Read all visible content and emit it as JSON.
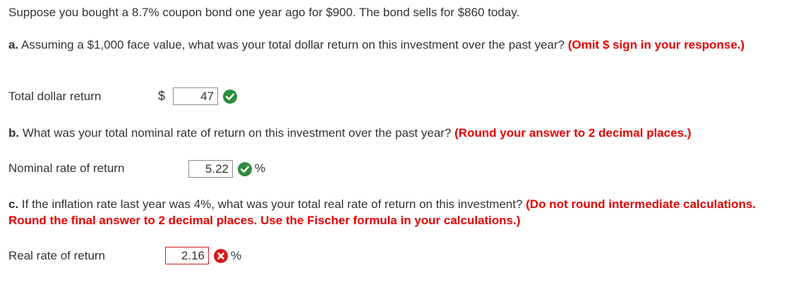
{
  "intro": "Suppose you bought a 8.7% coupon bond one year ago for $900. The bond sells for $860 today.",
  "part_a": {
    "letter": "a.",
    "question": " Assuming a $1,000 face value, what was your total dollar return on this investment over the past year? ",
    "instruction": "(Omit $ sign in your response.)",
    "label": "Total dollar return",
    "currency": "$",
    "answer": "47",
    "status": "correct"
  },
  "part_b": {
    "letter": "b.",
    "question": " What was your total nominal rate of return on this investment over the past year? ",
    "instruction": "(Round your answer to 2 decimal places.)",
    "label": "Nominal rate of return",
    "answer": "5.22",
    "unit": "%",
    "status": "correct"
  },
  "part_c": {
    "letter": "c.",
    "question": " If the inflation rate last year was 4%, what was your total real rate of return on this investment? ",
    "instruction": "(Do not round intermediate calculations. Round the final answer to 2 decimal places. Use the Fischer formula in your calculations.)",
    "label": "Real rate of return",
    "answer": "2.16",
    "unit": "%",
    "status": "incorrect"
  },
  "colors": {
    "instruction": "#e60000",
    "correct": "#2e8b3c",
    "incorrect": "#d61c1c",
    "text": "#333333"
  },
  "icons": {
    "correct": "check-circle-icon",
    "incorrect": "x-circle-icon"
  }
}
